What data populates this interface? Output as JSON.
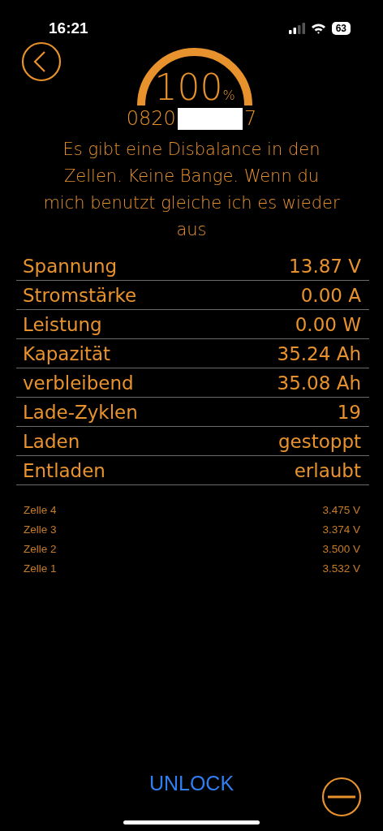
{
  "status_bar": {
    "time": "16:21",
    "battery": "63"
  },
  "gauge": {
    "value": "100",
    "unit": "%"
  },
  "serial": {
    "prefix": "0820",
    "suffix": "7"
  },
  "message": "Es gibt eine Disbalance in den Zellen. Keine Bange. Wenn du mich benutzt gleiche ich es wieder aus",
  "stats": [
    {
      "label": "Spannung",
      "value": "13.87 V"
    },
    {
      "label": "Stromstärke",
      "value": "0.00 A"
    },
    {
      "label": "Leistung",
      "value": "0.00 W"
    },
    {
      "label": "Kapazität",
      "value": "35.24 Ah"
    },
    {
      "label": "verbleibend",
      "value": "35.08 Ah"
    },
    {
      "label": "Lade-Zyklen",
      "value": "19"
    },
    {
      "label": "Laden",
      "value": "gestoppt"
    },
    {
      "label": "Entladen",
      "value": "erlaubt"
    }
  ],
  "cells": [
    {
      "label": "Zelle 4",
      "value": "3.475 V"
    },
    {
      "label": "Zelle 3",
      "value": "3.374 V"
    },
    {
      "label": "Zelle 2",
      "value": "3.500 V"
    },
    {
      "label": "Zelle 1",
      "value": "3.532 V"
    }
  ],
  "unlock_button": "UNLOCK"
}
